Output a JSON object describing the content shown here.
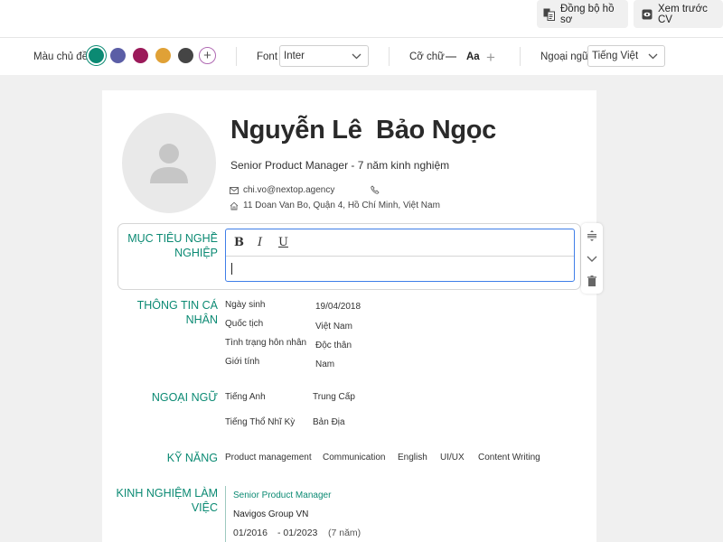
{
  "topbar": {
    "sync_label": "Đồng bộ hồ sơ",
    "preview_label": "Xem trước CV"
  },
  "toolbar": {
    "theme_color_label": "Màu chủ đề",
    "colors": [
      "#0b8a73",
      "#5b5ea6",
      "#9b1a5a",
      "#e0a136",
      "#454545"
    ],
    "selected_color": "#0b8a73",
    "font_label": "Font",
    "font_value": "Inter",
    "size_label": "Cỡ chữ",
    "size_glyph": "Aa",
    "language_label": "Ngoại ngữ",
    "language_value": "Tiếng Việt"
  },
  "profile": {
    "name": "Nguyễn Lê  Bảo Ngọc",
    "headline": "Senior Product Manager - 7 năm kinh nghiệm",
    "email": "chi.vo@nextop.agency",
    "address": "11 Doan Van Bo, Quận 4, Hồ Chí Minh, Việt Nam"
  },
  "objective": {
    "title_line1": "MỤC TIÊU NGHỀ",
    "title_line2": "NGHIỆP",
    "bold": "B",
    "italic": "I",
    "underline": "U"
  },
  "personal": {
    "title_line1": "THÔNG TIN CÁ",
    "title_line2": "NHÂN",
    "rows": [
      {
        "label": "Ngày sinh",
        "value": "19/04/2018"
      },
      {
        "label": "Quốc tịch",
        "value": "Việt Nam"
      },
      {
        "label": "Tình trạng hôn nhân",
        "value": "Độc thân"
      },
      {
        "label": "Giới tính",
        "value": "Nam"
      }
    ]
  },
  "languages": {
    "title": "NGOẠI NGỮ",
    "rows": [
      {
        "label": "Tiếng Anh",
        "value": "Trung Cấp"
      },
      {
        "label": "Tiếng Thổ Nhĩ Kỳ",
        "value": "Bản Địa"
      }
    ]
  },
  "skills": {
    "title": "KỸ NĂNG",
    "items": [
      "Product management",
      "Communication",
      "English",
      "UI/UX",
      "Content Writing"
    ]
  },
  "experience": {
    "title_line1": "KINH NGHIỆM LÀM",
    "title_line2": "VIỆC",
    "job_title": "Senior Product Manager",
    "company": "Navigos Group VN",
    "start": "01/2016",
    "end": "- 01/2023",
    "duration": "(7 năm)"
  }
}
